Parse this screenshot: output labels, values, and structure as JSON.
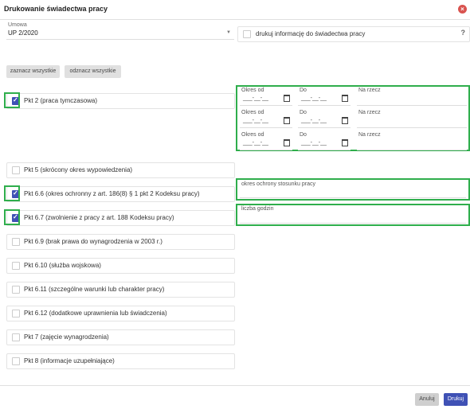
{
  "dialog": {
    "title": "Drukowanie świadectwa pracy",
    "close_icon": "×"
  },
  "umowa": {
    "label": "Umowa",
    "value": "UP 2/2020"
  },
  "print_info": {
    "label": "drukuj informację do świadectwa pracy",
    "help": "?"
  },
  "buttons": {
    "select_all": "zaznacz wszystkie",
    "deselect_all": "odznacz wszystkie",
    "cancel": "Anuluj",
    "print": "Drukuj"
  },
  "items": [
    {
      "label": "Pkt 2 (praca tymczasowa)",
      "checked": true
    },
    {
      "label": "Pkt 5 (skrócony okres wypowiedzenia)",
      "checked": false
    },
    {
      "label": "Pkt 6.6 (okres ochronny z art. 186(8) § 1 pkt 2 Kodeksu pracy)",
      "checked": true
    },
    {
      "label": "Pkt 6.7 (zwolnienie z pracy z art. 188 Kodeksu pracy)",
      "checked": true
    },
    {
      "label": "Pkt 6.9 (brak prawa do wynagrodzenia w 2003 r.)",
      "checked": false
    },
    {
      "label": "Pkt 6.10 (służba wojskowa)",
      "checked": false
    },
    {
      "label": "Pkt 6.11 (szczególne warunki lub charakter pracy)",
      "checked": false
    },
    {
      "label": "Pkt 6.12 (dodatkowe uprawnienia lub świadczenia)",
      "checked": false
    },
    {
      "label": "Pkt 7 (zajęcie wynagrodzenia)",
      "checked": false
    },
    {
      "label": "Pkt 8 (informacje uzupełniające)",
      "checked": false
    }
  ],
  "periods": {
    "from_label": "Okres od",
    "to_label": "Do",
    "na_rzecz_label": "Na rzecz",
    "date_placeholder": "___-__-__"
  },
  "protection_period_label": "okres ochrony stosunku pracy",
  "hours_label": "liczba godzin",
  "icons": {
    "calendar": "calendar-icon",
    "close": "close-icon",
    "dropdown": "chevron-down-icon"
  },
  "colors": {
    "accent": "#3f51b5",
    "highlight": "#2fae4c",
    "close": "#d9534f"
  }
}
